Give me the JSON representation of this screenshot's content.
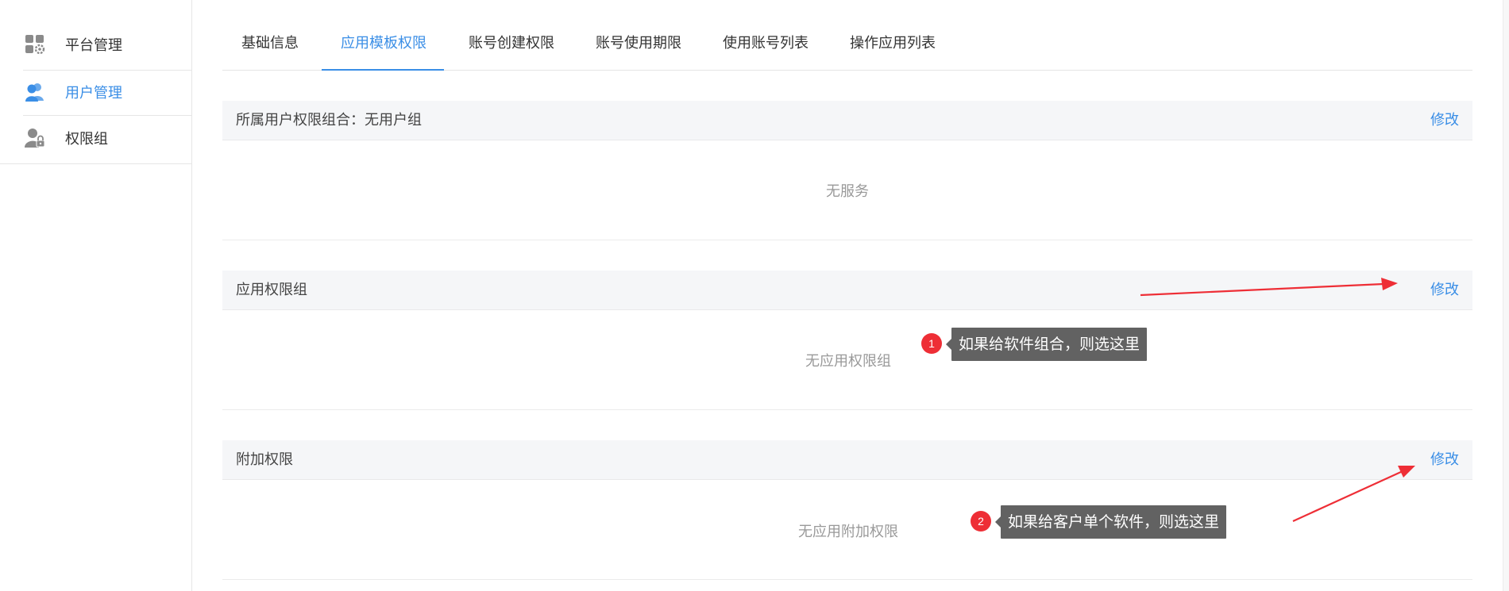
{
  "sidebar": {
    "items": [
      {
        "label": "平台管理",
        "icon": "grid-gear-icon"
      },
      {
        "label": "用户管理",
        "icon": "users-icon",
        "active": true
      },
      {
        "label": "权限组",
        "icon": "user-lock-icon"
      }
    ]
  },
  "tabs": [
    {
      "label": "基础信息"
    },
    {
      "label": "应用模板权限",
      "active": true
    },
    {
      "label": "账号创建权限"
    },
    {
      "label": "账号使用期限"
    },
    {
      "label": "使用账号列表"
    },
    {
      "label": "操作应用列表"
    }
  ],
  "sections": [
    {
      "title": "所属用户权限组合：无用户组",
      "edit_label": "修改",
      "empty_text": "无服务"
    },
    {
      "title": "应用权限组",
      "edit_label": "修改",
      "empty_text": "无应用权限组"
    },
    {
      "title": "附加权限",
      "edit_label": "修改",
      "empty_text": "无应用附加权限"
    }
  ],
  "annotations": [
    {
      "number": "1",
      "text": "如果给软件组合，则选这里"
    },
    {
      "number": "2",
      "text": "如果给客户单个软件，则选这里"
    }
  ],
  "colors": {
    "accent": "#3a8ee6",
    "annotation_badge": "#ee2e36",
    "annotation_tip": "#626262",
    "arrow": "#ee2e36",
    "section_header_bg": "#f5f6f8"
  }
}
